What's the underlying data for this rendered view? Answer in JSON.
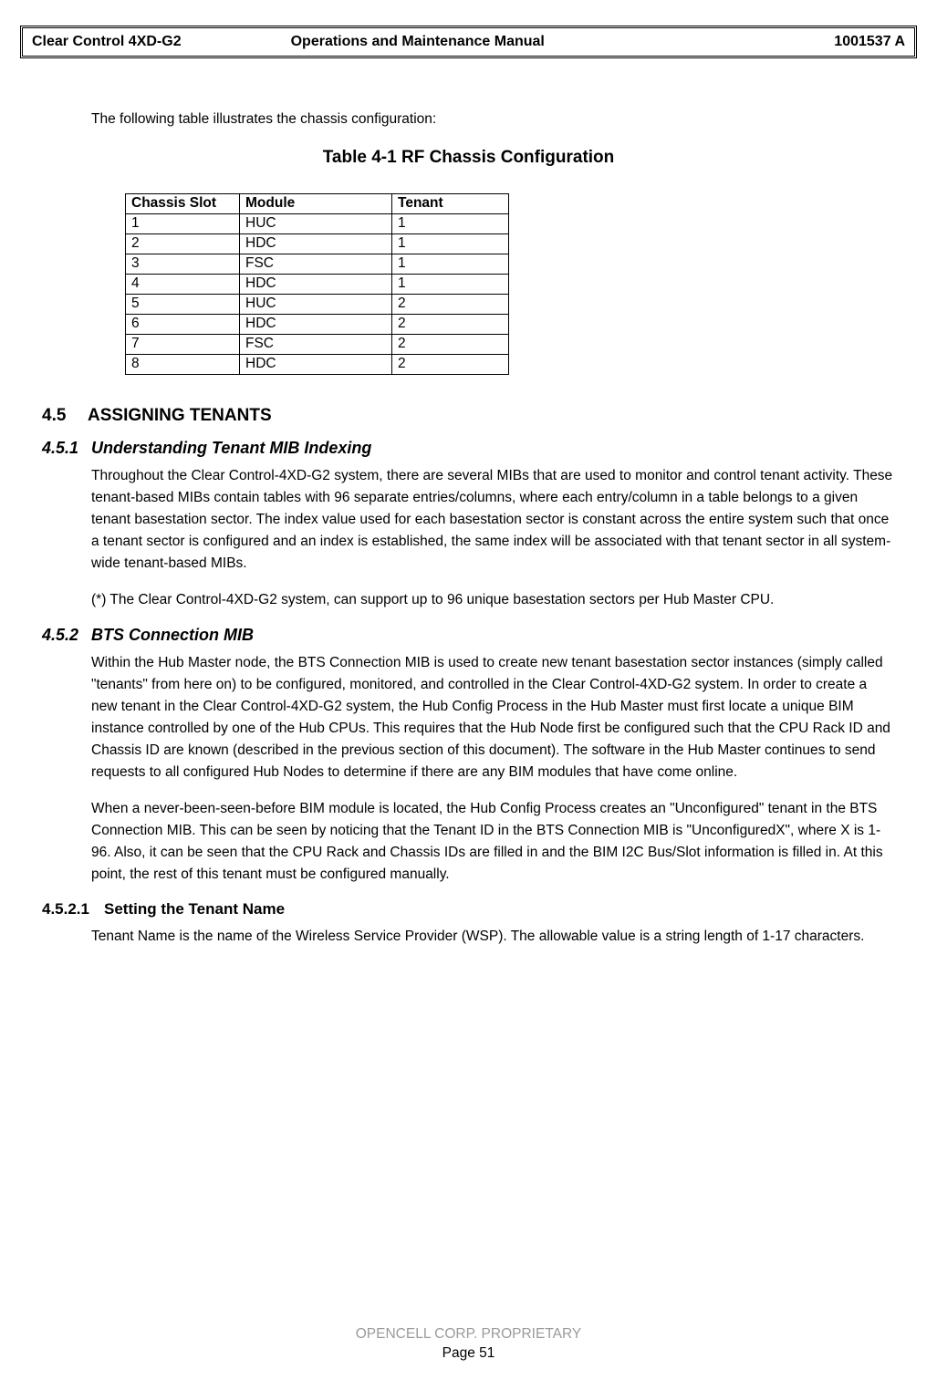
{
  "header": {
    "left": "Clear Control 4XD-G2",
    "center": "Operations and Maintenance Manual",
    "right": "1001537 A"
  },
  "intro": "The following table illustrates the chassis configuration:",
  "table_caption": "Table 4-1 RF Chassis Configuration",
  "chart_data": {
    "type": "table",
    "title": "Table 4-1 RF Chassis Configuration",
    "columns": [
      "Chassis Slot",
      "Module",
      "Tenant"
    ],
    "rows": [
      [
        "1",
        "HUC",
        "1"
      ],
      [
        "2",
        "HDC",
        "1"
      ],
      [
        "3",
        "FSC",
        "1"
      ],
      [
        "4",
        "HDC",
        "1"
      ],
      [
        "5",
        "HUC",
        "2"
      ],
      [
        "6",
        "HDC",
        "2"
      ],
      [
        "7",
        "FSC",
        "2"
      ],
      [
        "8",
        "HDC",
        "2"
      ]
    ]
  },
  "section_4_5": {
    "num": "4.5",
    "title": "ASSIGNING TENANTS"
  },
  "section_4_5_1": {
    "num": "4.5.1",
    "title": "Understanding Tenant MIB Indexing",
    "p1": "Throughout the Clear Control-4XD-G2 system, there are several MIBs that are used to monitor and control tenant activity. These tenant-based MIBs contain tables with 96 separate entries/columns, where each entry/column in a table belongs to a given tenant basestation sector. The index value used for each basestation sector is constant across the entire system such that once a tenant sector is configured and an index is established, the same index will be associated with that tenant sector in all system-wide tenant-based MIBs.",
    "p2": "(*) The Clear Control-4XD-G2 system, can support up to 96 unique basestation sectors per Hub Master CPU."
  },
  "section_4_5_2": {
    "num": "4.5.2",
    "title": "BTS Connection MIB",
    "p1": "Within the Hub Master node, the BTS Connection MIB is used to create new tenant basestation sector instances (simply called \"tenants\" from here on) to be configured, monitored, and controlled in the Clear Control-4XD-G2 system. In order to create a new tenant in the Clear Control-4XD-G2 system, the Hub Config Process in the Hub Master must first locate a unique BIM instance controlled by one of the Hub CPUs. This requires that the Hub Node first be configured such that the CPU Rack ID and Chassis ID are known  (described in the previous section of this document). The software in the Hub Master continues to send requests to all configured Hub Nodes to determine if there are any BIM modules that have come online.",
    "p2": "When a never-been-seen-before BIM module is located, the Hub Config Process creates an \"Unconfigured\" tenant in the BTS Connection MIB. This can be seen by noticing that the Tenant ID in the BTS Connection MIB is \"UnconfiguredX\", where X is 1-96. Also, it can be seen that the CPU Rack and Chassis IDs are filled in and the BIM I2C Bus/Slot information is filled in. At this point, the rest of this tenant must be configured manually."
  },
  "section_4_5_2_1": {
    "num": "4.5.2.1",
    "title": "Setting the Tenant Name",
    "p1": "Tenant Name is the name of the Wireless Service Provider (WSP). The allowable value is a string length of 1-17 characters."
  },
  "footer": {
    "line1": "OPENCELL CORP.  PROPRIETARY",
    "line2": "Page 51"
  }
}
